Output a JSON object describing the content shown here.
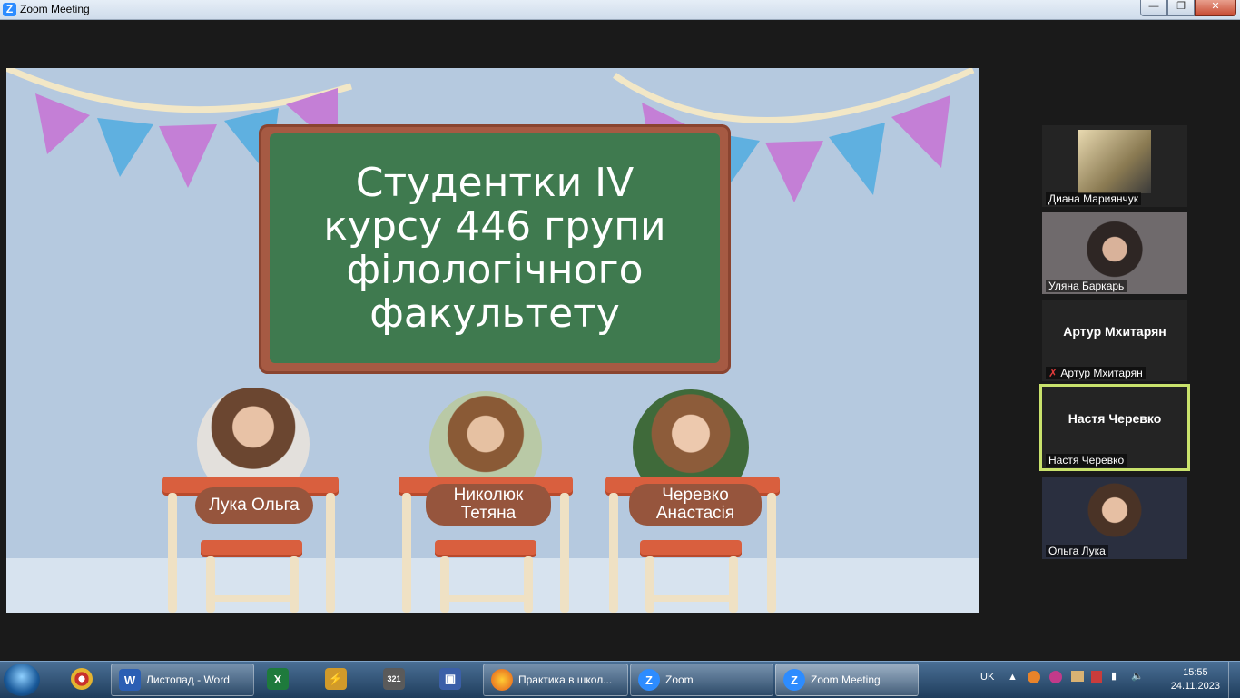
{
  "window": {
    "title": "Zoom Meeting",
    "app_icon": "zoom-icon"
  },
  "slide": {
    "board_text": "Студентки IV курсу 446 групи філологічного факультету",
    "students": [
      {
        "name_line1": "Лука Ольга",
        "name_line2": ""
      },
      {
        "name_line1": "Николюк",
        "name_line2": "Тетяна"
      },
      {
        "name_line1": "Черевко",
        "name_line2": "Анастасія"
      }
    ]
  },
  "participants": [
    {
      "name": "Диана Мариянчук",
      "display": "",
      "muted": false,
      "active": false
    },
    {
      "name": "Уляна Баркарь",
      "display": "",
      "muted": false,
      "active": false
    },
    {
      "name": "Артур Мхитарян",
      "display": "Артур Мхитарян",
      "muted": true,
      "active": false
    },
    {
      "name": "Настя Черевко",
      "display": "Настя Черевко",
      "muted": false,
      "active": true
    },
    {
      "name": "Ольга Лука",
      "display": "",
      "muted": false,
      "active": false
    }
  ],
  "taskbar": {
    "items": [
      {
        "label": "Листопад - Word",
        "icon": "word-icon",
        "color": "#2b5fb4"
      },
      {
        "label": "",
        "icon": "excel-icon",
        "color": "#1e7a3c"
      },
      {
        "label": "",
        "icon": "winamp-icon",
        "color": "#d19a2a"
      },
      {
        "label": "",
        "icon": "media-player-icon",
        "color": "#5a5a5a"
      },
      {
        "label": "",
        "icon": "save-icon",
        "color": "#3b5fa8"
      },
      {
        "label": "Практика в школ...",
        "icon": "firefox-icon",
        "color": "#e25a1c"
      },
      {
        "label": "Zoom",
        "icon": "zoom-icon",
        "color": "#2d8cff"
      },
      {
        "label": "Zoom Meeting",
        "icon": "zoom-icon",
        "color": "#2d8cff"
      }
    ],
    "language": "UK",
    "time": "15:55",
    "date": "24.11.2023"
  }
}
